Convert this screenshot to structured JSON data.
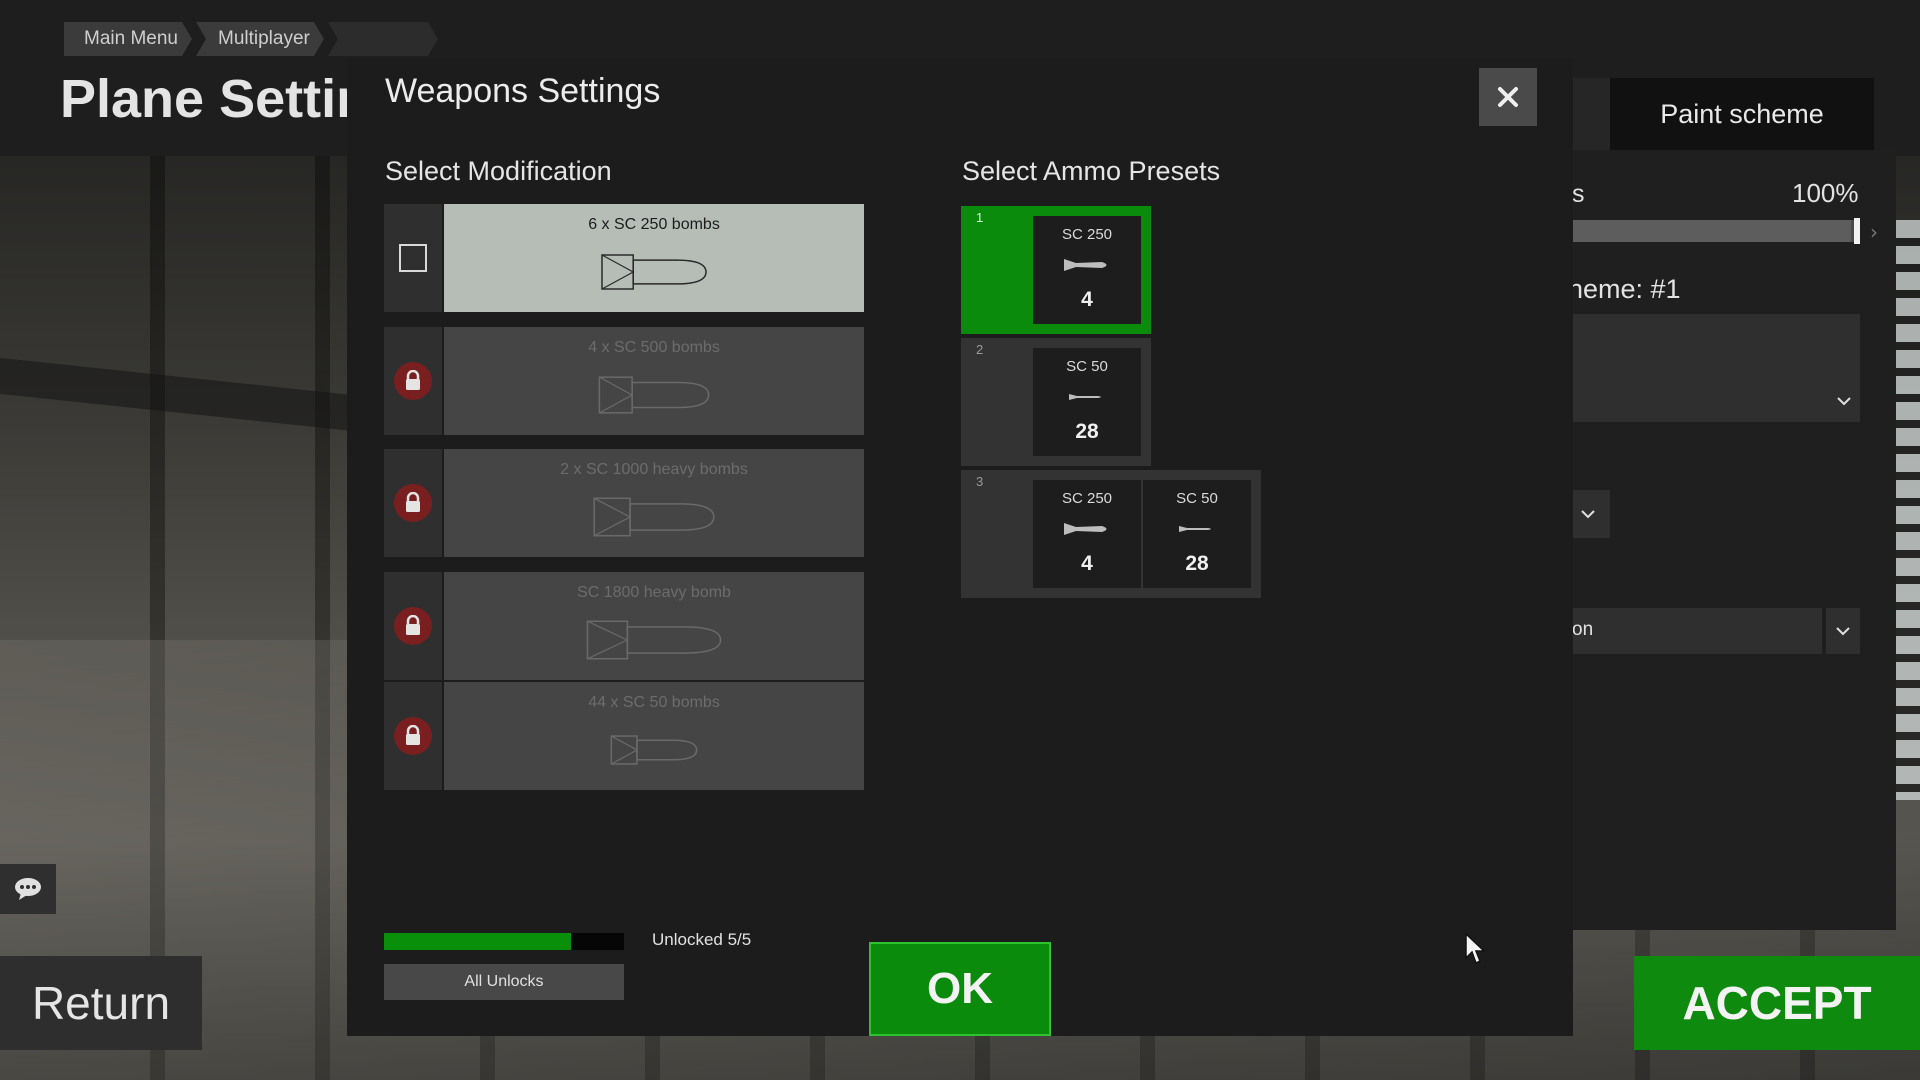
{
  "breadcrumb": [
    "Main Menu",
    "Multiplayer"
  ],
  "page_title": "Plane Settir",
  "side_panel": {
    "tab_label": "Paint scheme",
    "row_label_partial": "s",
    "slider_value": "100%",
    "slider_fraction": 0.97,
    "scheme_label_partial": "heme: #1",
    "dropdown_value_partial": "on"
  },
  "bottom": {
    "return_label": "Return",
    "accept_label": "ACCEPT"
  },
  "modal": {
    "title": "Weapons Settings",
    "modification_title": "Select Modification",
    "ammo_title": "Select Ammo Presets",
    "modifications": [
      {
        "label": "6 x SC 250 bombs",
        "selected": true,
        "locked": false
      },
      {
        "label": "4 x SC 500 bombs",
        "selected": false,
        "locked": true
      },
      {
        "label": "2 x SC 1000 heavy bombs",
        "selected": false,
        "locked": true
      },
      {
        "label": "SC 1800 heavy bomb",
        "selected": false,
        "locked": true
      },
      {
        "label": "44 x SC 50 bombs",
        "selected": false,
        "locked": true
      }
    ],
    "presets": [
      {
        "number": "1",
        "selected": true,
        "items": [
          {
            "name": "SC 250",
            "count": "4"
          }
        ]
      },
      {
        "number": "2",
        "selected": false,
        "items": [
          {
            "name": "SC 50",
            "count": "28"
          }
        ]
      },
      {
        "number": "3",
        "selected": false,
        "items": [
          {
            "name": "SC 250",
            "count": "4"
          },
          {
            "name": "SC 50",
            "count": "28"
          }
        ]
      }
    ],
    "unlock_progress": 0.78,
    "unlocked_text": "Unlocked 5/5",
    "all_unlocks_label": "All Unlocks",
    "ok_label": "OK"
  },
  "colors": {
    "accent_green": "#0b8b0b",
    "lock_red": "#7a1f1f",
    "selected_mod": "#b6bdb7"
  },
  "icons": [
    "close-icon",
    "lock-icon",
    "chat-icon",
    "chevron-down-icon",
    "bomb-icon",
    "cursor-icon"
  ]
}
